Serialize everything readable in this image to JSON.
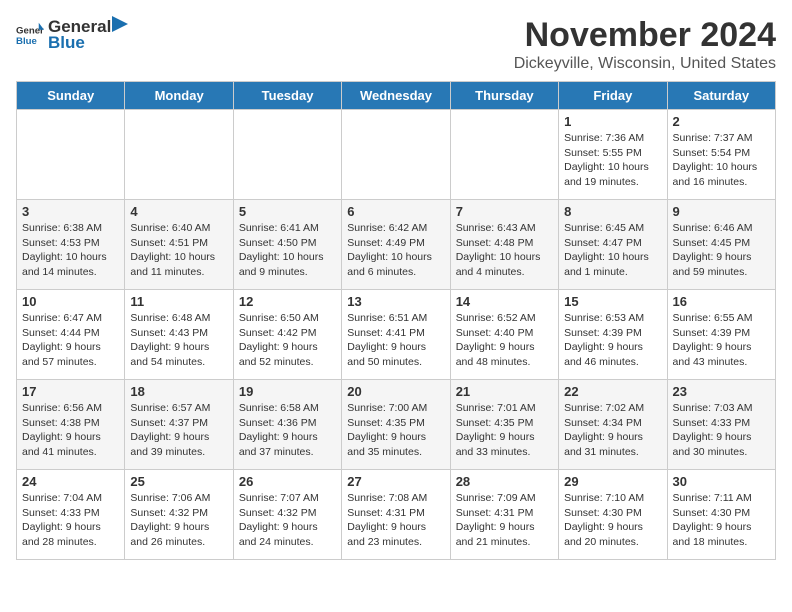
{
  "header": {
    "logo_general": "General",
    "logo_blue": "Blue",
    "title": "November 2024",
    "subtitle": "Dickeyville, Wisconsin, United States"
  },
  "days_of_week": [
    "Sunday",
    "Monday",
    "Tuesday",
    "Wednesday",
    "Thursday",
    "Friday",
    "Saturday"
  ],
  "weeks": [
    [
      {
        "day": "",
        "info": ""
      },
      {
        "day": "",
        "info": ""
      },
      {
        "day": "",
        "info": ""
      },
      {
        "day": "",
        "info": ""
      },
      {
        "day": "",
        "info": ""
      },
      {
        "day": "1",
        "info": "Sunrise: 7:36 AM\nSunset: 5:55 PM\nDaylight: 10 hours and 19 minutes."
      },
      {
        "day": "2",
        "info": "Sunrise: 7:37 AM\nSunset: 5:54 PM\nDaylight: 10 hours and 16 minutes."
      }
    ],
    [
      {
        "day": "3",
        "info": "Sunrise: 6:38 AM\nSunset: 4:53 PM\nDaylight: 10 hours and 14 minutes."
      },
      {
        "day": "4",
        "info": "Sunrise: 6:40 AM\nSunset: 4:51 PM\nDaylight: 10 hours and 11 minutes."
      },
      {
        "day": "5",
        "info": "Sunrise: 6:41 AM\nSunset: 4:50 PM\nDaylight: 10 hours and 9 minutes."
      },
      {
        "day": "6",
        "info": "Sunrise: 6:42 AM\nSunset: 4:49 PM\nDaylight: 10 hours and 6 minutes."
      },
      {
        "day": "7",
        "info": "Sunrise: 6:43 AM\nSunset: 4:48 PM\nDaylight: 10 hours and 4 minutes."
      },
      {
        "day": "8",
        "info": "Sunrise: 6:45 AM\nSunset: 4:47 PM\nDaylight: 10 hours and 1 minute."
      },
      {
        "day": "9",
        "info": "Sunrise: 6:46 AM\nSunset: 4:45 PM\nDaylight: 9 hours and 59 minutes."
      }
    ],
    [
      {
        "day": "10",
        "info": "Sunrise: 6:47 AM\nSunset: 4:44 PM\nDaylight: 9 hours and 57 minutes."
      },
      {
        "day": "11",
        "info": "Sunrise: 6:48 AM\nSunset: 4:43 PM\nDaylight: 9 hours and 54 minutes."
      },
      {
        "day": "12",
        "info": "Sunrise: 6:50 AM\nSunset: 4:42 PM\nDaylight: 9 hours and 52 minutes."
      },
      {
        "day": "13",
        "info": "Sunrise: 6:51 AM\nSunset: 4:41 PM\nDaylight: 9 hours and 50 minutes."
      },
      {
        "day": "14",
        "info": "Sunrise: 6:52 AM\nSunset: 4:40 PM\nDaylight: 9 hours and 48 minutes."
      },
      {
        "day": "15",
        "info": "Sunrise: 6:53 AM\nSunset: 4:39 PM\nDaylight: 9 hours and 46 minutes."
      },
      {
        "day": "16",
        "info": "Sunrise: 6:55 AM\nSunset: 4:39 PM\nDaylight: 9 hours and 43 minutes."
      }
    ],
    [
      {
        "day": "17",
        "info": "Sunrise: 6:56 AM\nSunset: 4:38 PM\nDaylight: 9 hours and 41 minutes."
      },
      {
        "day": "18",
        "info": "Sunrise: 6:57 AM\nSunset: 4:37 PM\nDaylight: 9 hours and 39 minutes."
      },
      {
        "day": "19",
        "info": "Sunrise: 6:58 AM\nSunset: 4:36 PM\nDaylight: 9 hours and 37 minutes."
      },
      {
        "day": "20",
        "info": "Sunrise: 7:00 AM\nSunset: 4:35 PM\nDaylight: 9 hours and 35 minutes."
      },
      {
        "day": "21",
        "info": "Sunrise: 7:01 AM\nSunset: 4:35 PM\nDaylight: 9 hours and 33 minutes."
      },
      {
        "day": "22",
        "info": "Sunrise: 7:02 AM\nSunset: 4:34 PM\nDaylight: 9 hours and 31 minutes."
      },
      {
        "day": "23",
        "info": "Sunrise: 7:03 AM\nSunset: 4:33 PM\nDaylight: 9 hours and 30 minutes."
      }
    ],
    [
      {
        "day": "24",
        "info": "Sunrise: 7:04 AM\nSunset: 4:33 PM\nDaylight: 9 hours and 28 minutes."
      },
      {
        "day": "25",
        "info": "Sunrise: 7:06 AM\nSunset: 4:32 PM\nDaylight: 9 hours and 26 minutes."
      },
      {
        "day": "26",
        "info": "Sunrise: 7:07 AM\nSunset: 4:32 PM\nDaylight: 9 hours and 24 minutes."
      },
      {
        "day": "27",
        "info": "Sunrise: 7:08 AM\nSunset: 4:31 PM\nDaylight: 9 hours and 23 minutes."
      },
      {
        "day": "28",
        "info": "Sunrise: 7:09 AM\nSunset: 4:31 PM\nDaylight: 9 hours and 21 minutes."
      },
      {
        "day": "29",
        "info": "Sunrise: 7:10 AM\nSunset: 4:30 PM\nDaylight: 9 hours and 20 minutes."
      },
      {
        "day": "30",
        "info": "Sunrise: 7:11 AM\nSunset: 4:30 PM\nDaylight: 9 hours and 18 minutes."
      }
    ]
  ]
}
